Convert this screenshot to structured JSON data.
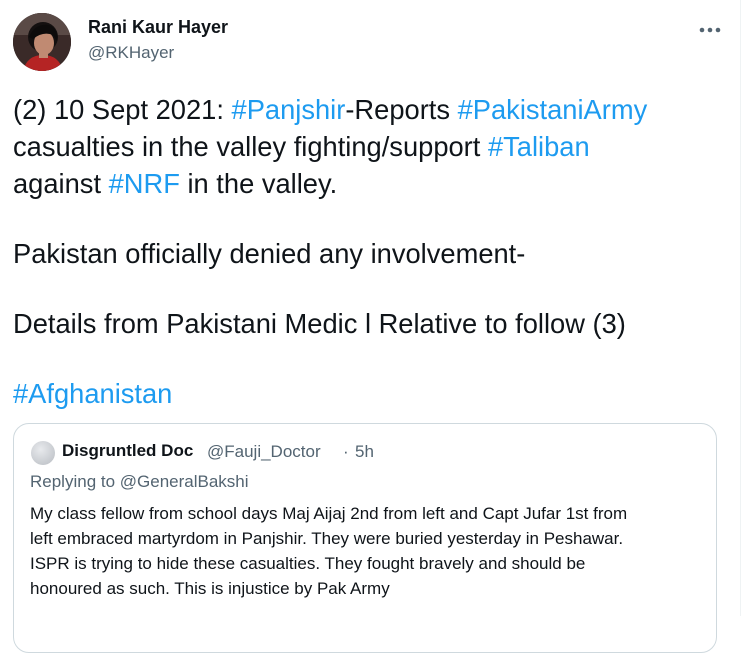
{
  "tweet": {
    "author_name": "Rani Kaur Hayer",
    "author_handle": "@RKHayer",
    "more_icon": "more-dots-icon",
    "line1_prefix": "(2) 10 Sept 2021: ",
    "line1_hashtag1": "#Panjshir",
    "line1_middle": "-Reports ",
    "line1_hashtag2": "#PakistaniArmy",
    "line2_text": "casualties in the valley fighting/support ",
    "line2_hashtag": "#Taliban",
    "line3_prefix": "against ",
    "line3_hashtag": "#NRF",
    "line3_suffix": " in the valley.",
    "para2": "Pakistan officially denied any involvement-",
    "para3": "Details from Pakistani Medic l Relative to follow (3)",
    "para4_hashtag": "#Afghanistan"
  },
  "quote": {
    "author_name": "Disgruntled Doc",
    "author_handle": "@Fauji_Doctor",
    "separator": "·",
    "time": "5h",
    "replying_prefix": "Replying to ",
    "replying_handle": "@GeneralBakshi",
    "text_lines": [
      "My class fellow from school days Maj Aijaj 2nd from left and Capt Jufar 1st from",
      "left embraced martyrdom in Panjshir. They were buried yesterday in Peshawar.",
      "ISPR is trying to hide these casualties. They fought bravely and should be",
      "honoured as such. This is injustice by Pak Army"
    ]
  },
  "colors": {
    "hashtag": "#1d9bf0",
    "text": "#0f1419",
    "secondary": "#536471",
    "border": "#cfd9de"
  }
}
